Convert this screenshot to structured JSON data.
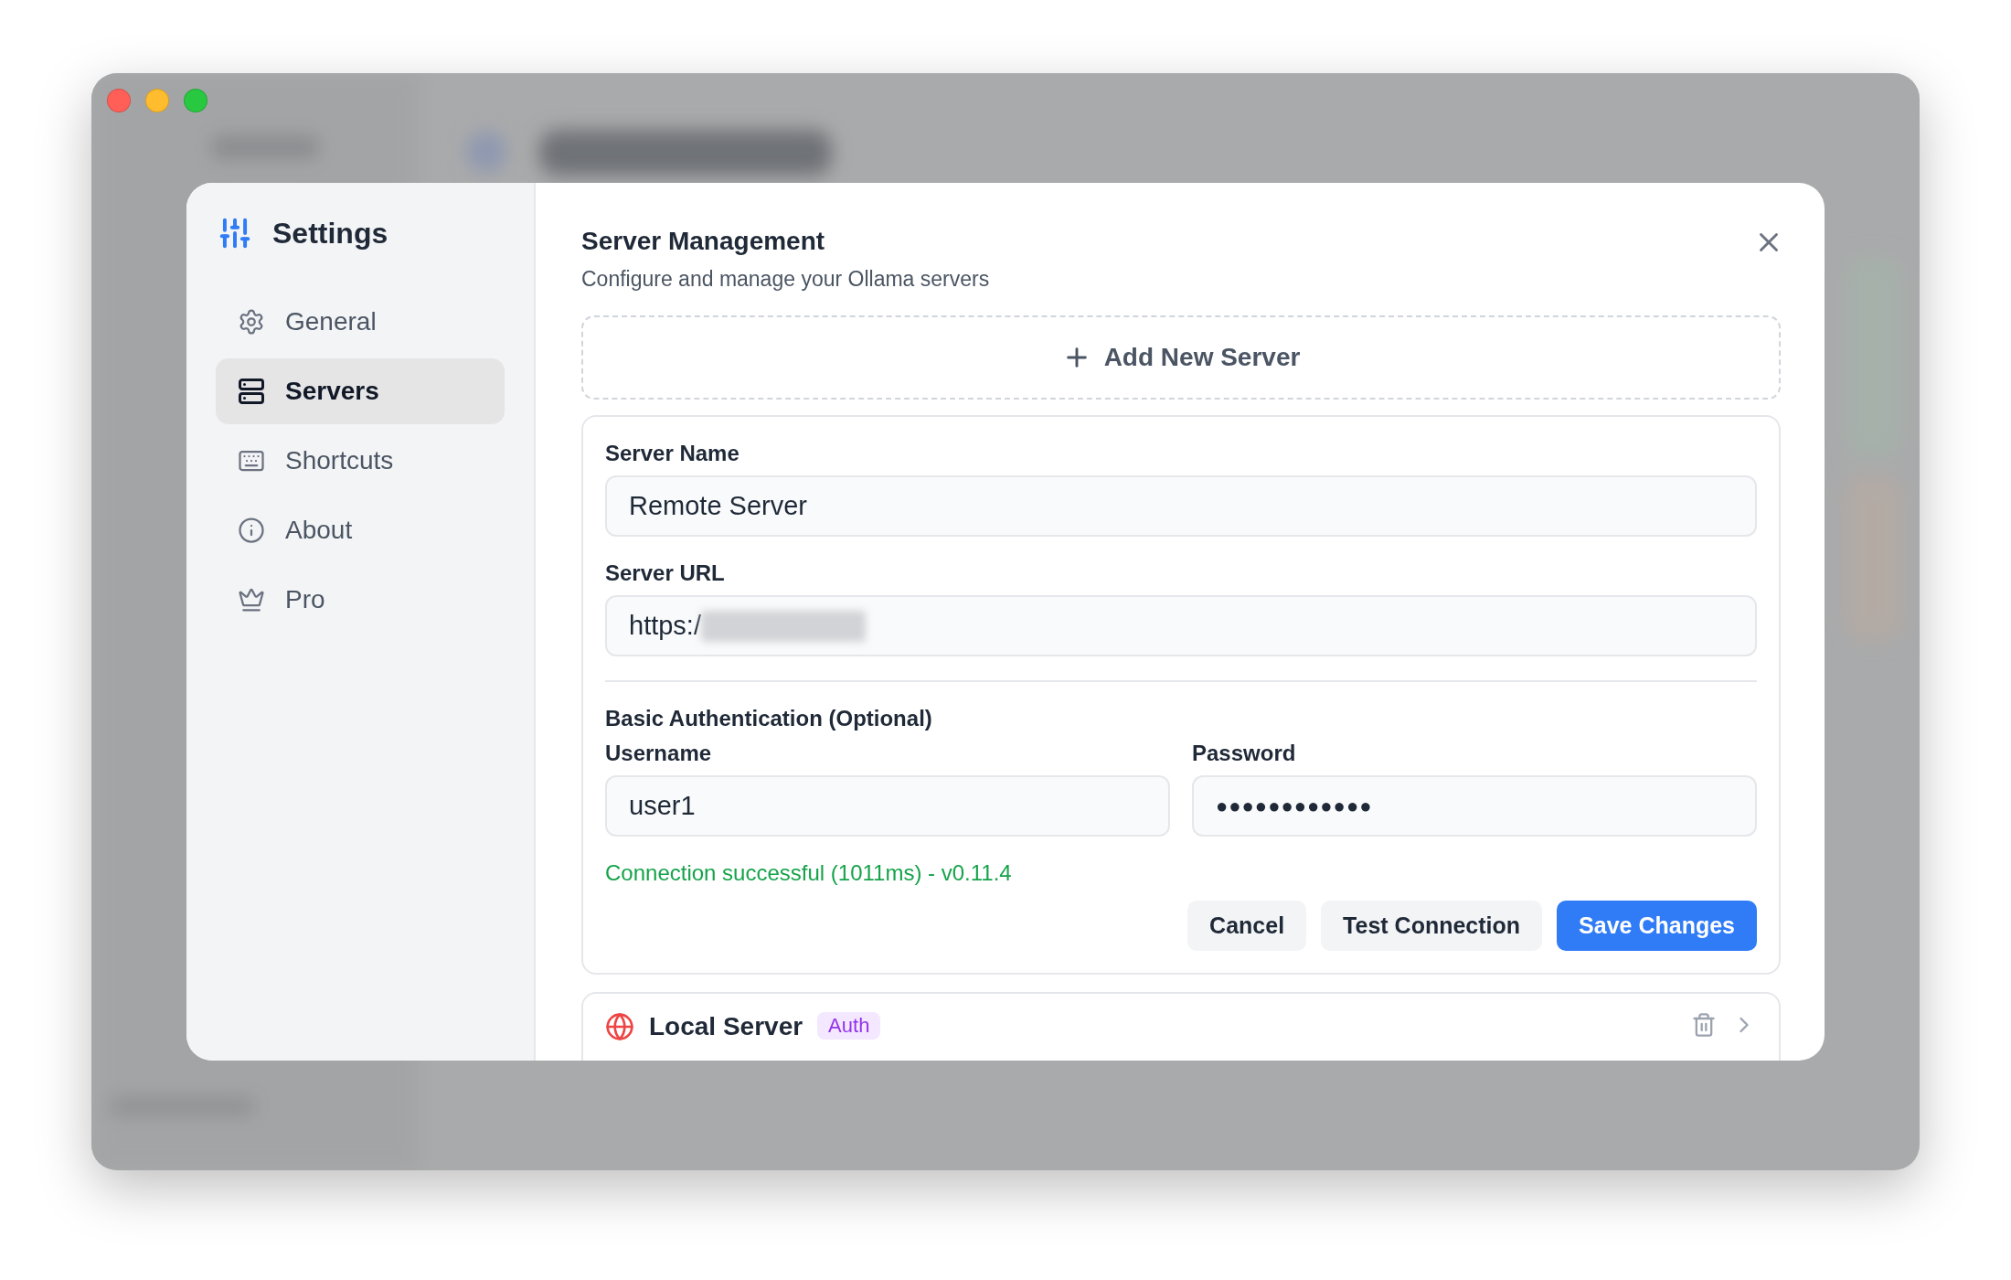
{
  "sidebar": {
    "title": "Settings",
    "items": [
      {
        "label": "General",
        "selected": false
      },
      {
        "label": "Servers",
        "selected": true
      },
      {
        "label": "Shortcuts",
        "selected": false
      },
      {
        "label": "About",
        "selected": false
      },
      {
        "label": "Pro",
        "selected": false
      }
    ]
  },
  "panel": {
    "title": "Server Management",
    "subtitle": "Configure and manage your Ollama servers",
    "add_button": "Add New Server",
    "form": {
      "name_label": "Server Name",
      "name_value": "Remote Server",
      "url_label": "Server URL",
      "url_value": "https:/",
      "auth_title": "Basic Authentication (Optional)",
      "username_label": "Username",
      "username_value": "user1",
      "password_label": "Password",
      "password_value": "●●●●●●●●●●●●",
      "status": "Connection successful (1011ms) - v0.11.4",
      "buttons": [
        {
          "label": "Cancel",
          "kind": "secondary"
        },
        {
          "label": "Test Connection",
          "kind": "secondary"
        },
        {
          "label": "Save Changes",
          "kind": "primary"
        }
      ]
    },
    "servers": [
      {
        "name": "Local Server",
        "badge": "Auth"
      }
    ]
  }
}
